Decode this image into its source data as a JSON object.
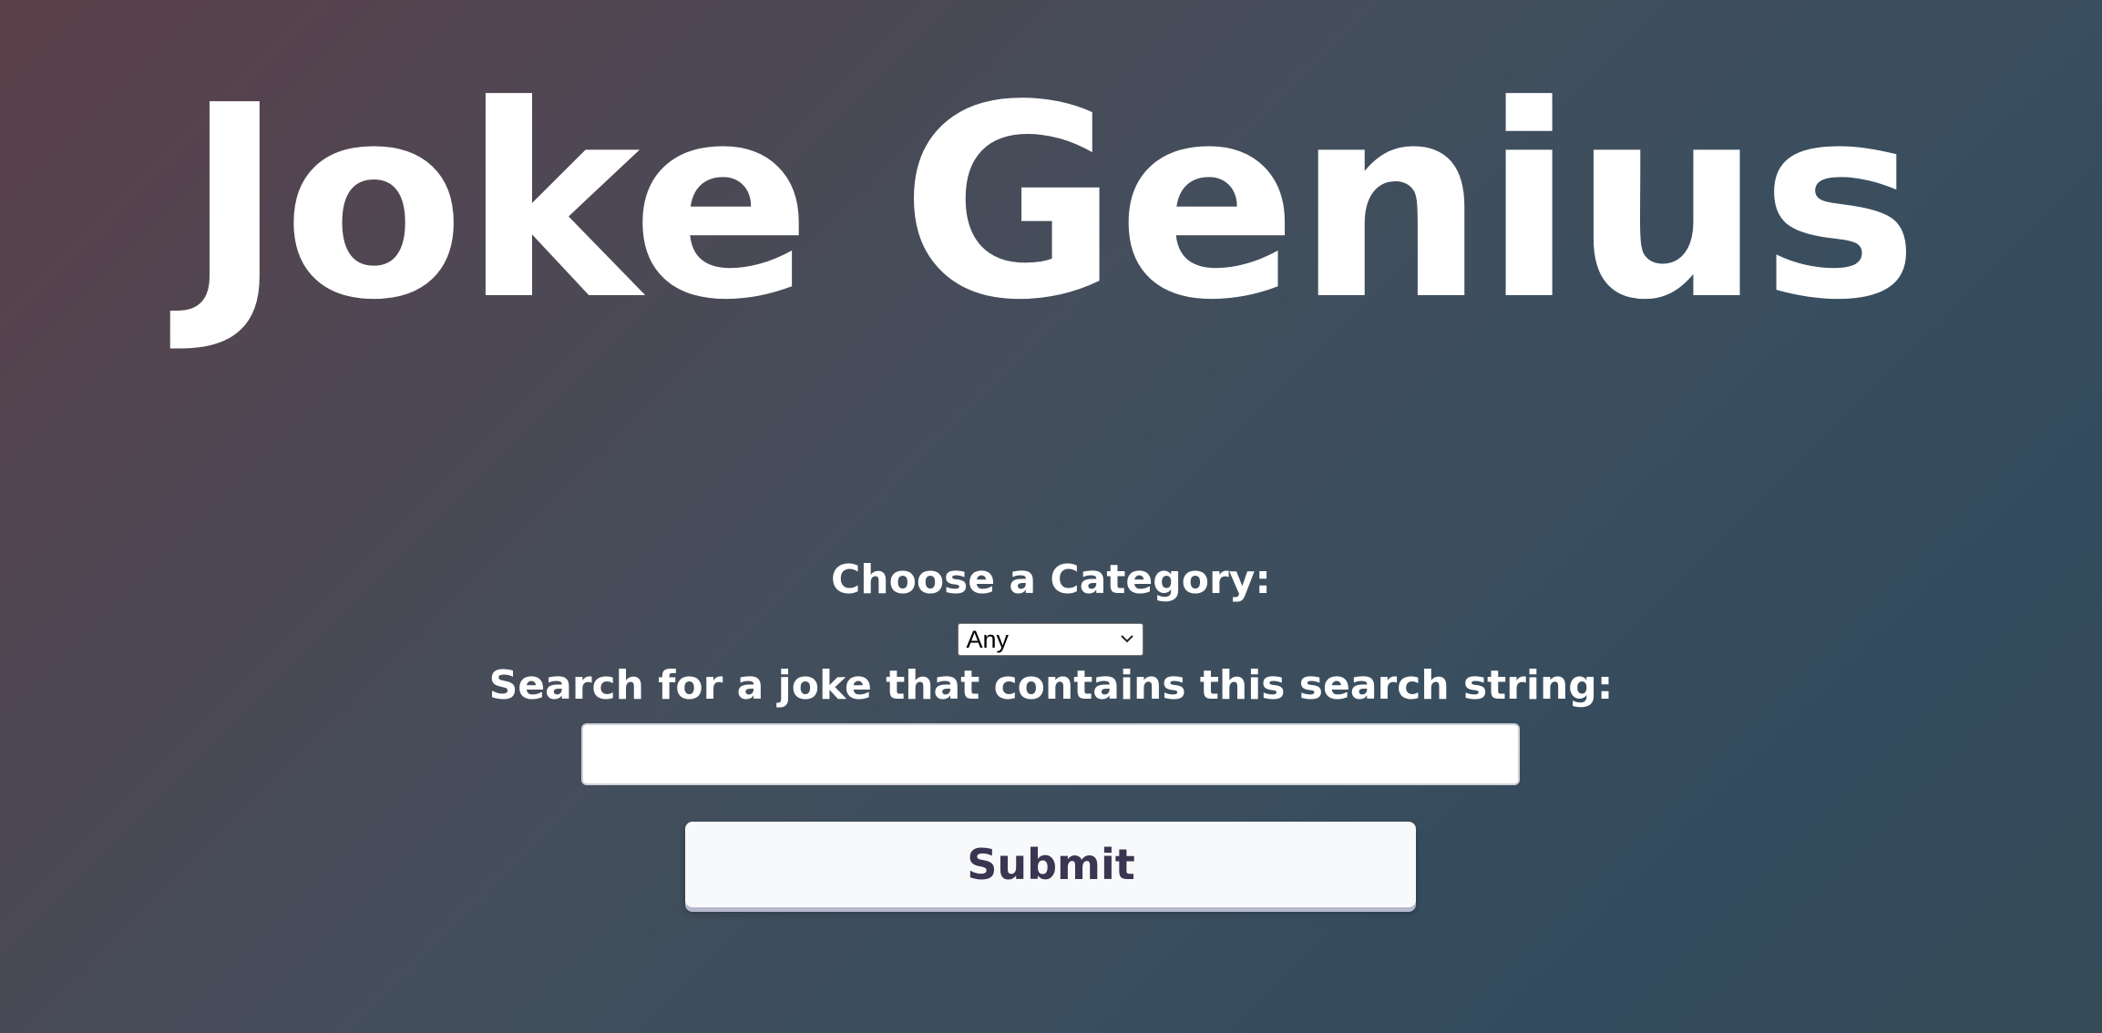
{
  "header": {
    "title": "Joke Genius"
  },
  "form": {
    "category_label": "Choose a Category:",
    "category_select": {
      "selected": "Any"
    },
    "search_label": "Search for a joke that contains this search string:",
    "search_input": {
      "value": "",
      "placeholder": ""
    },
    "submit_label": "Submit"
  },
  "colors": {
    "text": "#ffffff",
    "button_text": "#3a3550",
    "button_bg": "#f8f9fa",
    "button_shadow": "#b6b8cc"
  },
  "icons": {
    "select_arrow": "chevron-down-icon"
  }
}
